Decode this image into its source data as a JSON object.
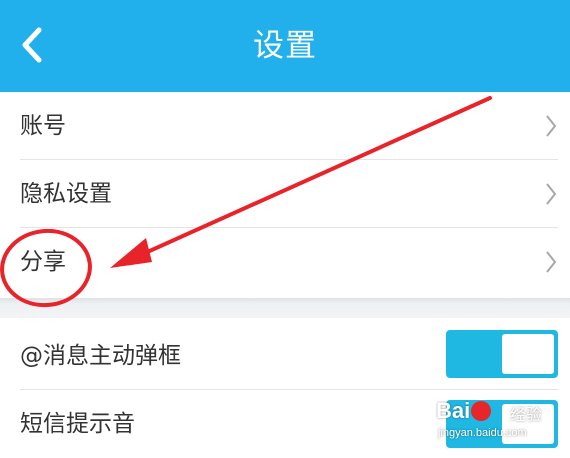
{
  "header": {
    "title": "设置",
    "back_icon": "chevron-left-icon",
    "background": "#21b0eb"
  },
  "group1": {
    "items": [
      {
        "label": "账号"
      },
      {
        "label": "隐私设置"
      },
      {
        "label": "分享"
      }
    ]
  },
  "group2": {
    "items": [
      {
        "label": "@消息主动弹框",
        "enabled": true
      },
      {
        "label": "短信提示音",
        "enabled": true
      }
    ]
  },
  "annotation": {
    "color": "#e8232a",
    "circle_target": "分享"
  },
  "colors": {
    "accent": "#21b0eb",
    "toggle_on": "#1fb8e2"
  },
  "watermark": {
    "logo_left": "Bai",
    "logo_right": "经验",
    "url": "jingyan.baidu.com"
  }
}
